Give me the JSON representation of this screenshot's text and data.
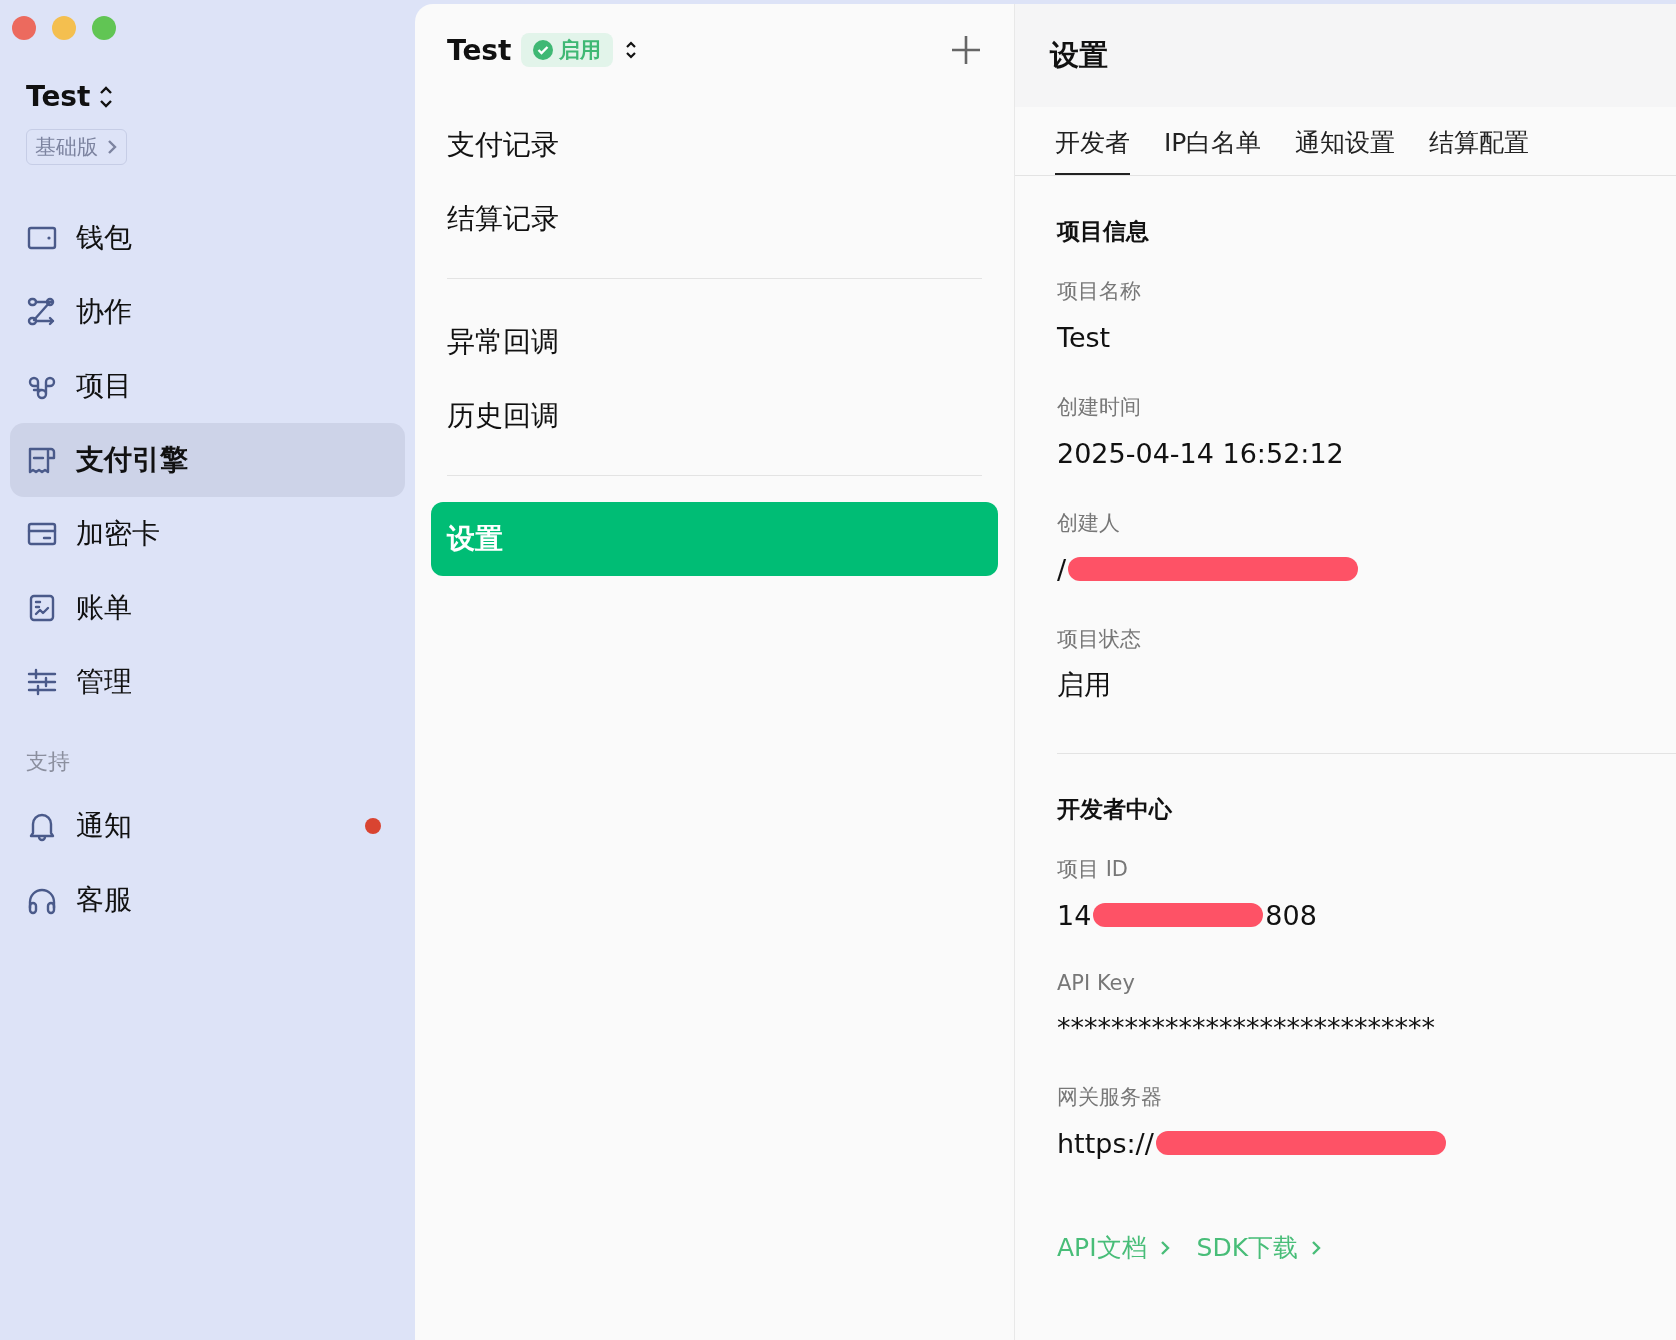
{
  "window": {
    "controls": [
      {
        "kind": "close"
      },
      {
        "kind": "minimize"
      },
      {
        "kind": "zoom"
      }
    ]
  },
  "sidebar": {
    "project": "Test",
    "plan": "基础版",
    "items": [
      {
        "label": "钱包",
        "selected": false
      },
      {
        "label": "协作",
        "selected": false
      },
      {
        "label": "项目",
        "selected": false
      },
      {
        "label": "支付引擎",
        "selected": true
      },
      {
        "label": "加密卡",
        "selected": false
      },
      {
        "label": "账单",
        "selected": false
      },
      {
        "label": "管理",
        "selected": false
      }
    ],
    "support_heading": "支持",
    "support_items": [
      {
        "label": "通知",
        "selected": false,
        "unread": true
      },
      {
        "label": "客服",
        "selected": false,
        "unread": false
      }
    ]
  },
  "middle": {
    "project": "Test",
    "status": "启用",
    "groups": [
      {
        "items": [
          {
            "label": "支付记录",
            "selected": false
          },
          {
            "label": "结算记录",
            "selected": false
          }
        ]
      },
      {
        "items": [
          {
            "label": "异常回调",
            "selected": false
          },
          {
            "label": "历史回调",
            "selected": false
          }
        ]
      },
      {
        "items": [
          {
            "label": "设置",
            "selected": true
          }
        ]
      }
    ]
  },
  "settings": {
    "title": "设置",
    "tabs": [
      {
        "label": "开发者",
        "selected": true
      },
      {
        "label": "IP白名单",
        "selected": false
      },
      {
        "label": "通知设置",
        "selected": false
      },
      {
        "label": "结算配置",
        "selected": false
      }
    ],
    "sections": [
      {
        "heading": "项目信息",
        "fields": [
          {
            "label": "项目名称",
            "value": "Test"
          },
          {
            "label": "创建时间",
            "value": "2025-04-14 16:52:12"
          },
          {
            "label": "创建人",
            "value": "/",
            "redacted": true
          },
          {
            "label": "项目状态",
            "value": "启用"
          }
        ]
      },
      {
        "heading": "开发者中心",
        "fields": [
          {
            "label": "项目 ID",
            "value": "14",
            "redacted": true,
            "value_end": "808"
          },
          {
            "label": "API Key",
            "value": "****************************"
          },
          {
            "label": "网关服务器",
            "value": "https://",
            "redacted": true
          }
        ]
      }
    ],
    "links": [
      "API文档",
      "SDK下载"
    ]
  }
}
